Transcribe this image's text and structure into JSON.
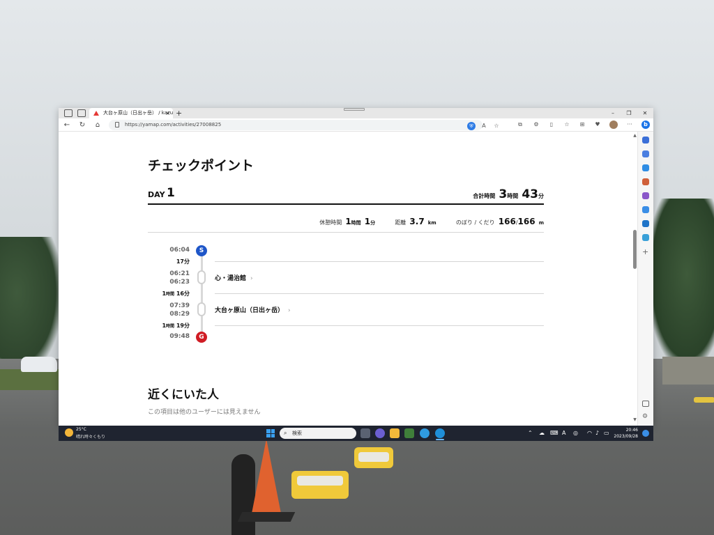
{
  "browser": {
    "tab_title": "大台ヶ原山（日出ヶ岳） / kazuhi",
    "tab_close": "×",
    "new_tab": "+",
    "url": "https://yamap.com/activities/27008825",
    "window_controls": {
      "minimize": "–",
      "restore": "❐",
      "close": "✕"
    }
  },
  "page": {
    "checkpoint_title": "チェックポイント",
    "day_label": "DAY",
    "day_number": "1",
    "total_label": "合計時間",
    "total_hours": "3",
    "total_hours_unit": "時間",
    "total_minutes": "43",
    "total_minutes_unit": "分",
    "stats": {
      "rest_label": "休憩時間",
      "rest_hours": "1",
      "rest_hours_unit": "時間",
      "rest_minutes": "1",
      "rest_minutes_unit": "分",
      "distance_label": "距離",
      "distance_value": "3.7",
      "distance_unit": "km",
      "updown_label": "のぼり / くだり",
      "up_value": "166",
      "separator": "/",
      "down_value": "166",
      "updown_unit": "m"
    },
    "timeline": {
      "start_time": "06:04",
      "start_badge": "S",
      "leg1_duration": "17分",
      "cp1_arrive": "06:21",
      "cp1_depart": "06:23",
      "cp1_name": "心・湯治館",
      "leg2_hours": "1",
      "leg2_hours_unit": "時間",
      "leg2_minutes": "16分",
      "cp2_arrive": "07:39",
      "cp2_depart": "08:29",
      "cp2_name": "大台ヶ原山（日出ヶ岳）",
      "leg3_hours": "1",
      "leg3_hours_unit": "時間",
      "leg3_minutes": "19分",
      "goal_time": "09:48",
      "goal_badge": "G",
      "chevron": "›"
    },
    "nearby_title": "近くにいた人",
    "nearby_note": "この項目は他のユーザーには見えません"
  },
  "taskbar": {
    "weather_temp": "25°C",
    "weather_desc": "晴れ時々くもり",
    "search_placeholder": "検索",
    "clock_time": "20:46",
    "clock_date": "2023/09/28"
  }
}
